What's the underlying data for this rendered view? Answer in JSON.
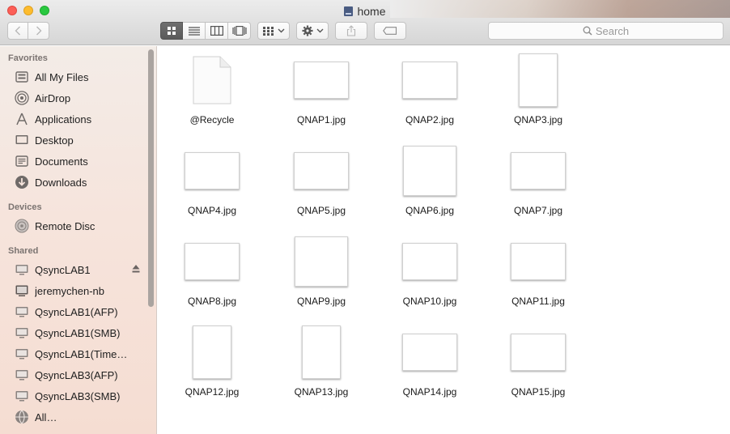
{
  "window": {
    "title": "home"
  },
  "toolbar": {
    "back_icon": "chevron-left-icon",
    "forward_icon": "chevron-right-icon",
    "view_modes": [
      "icon-view",
      "list-view",
      "column-view",
      "cover-flow-view"
    ],
    "active_view": "icon-view",
    "search_placeholder": "Search"
  },
  "sidebar": {
    "sections": [
      {
        "title": "Favorites",
        "items": [
          {
            "label": "All My Files",
            "icon": "all-files-icon"
          },
          {
            "label": "AirDrop",
            "icon": "airdrop-icon"
          },
          {
            "label": "Applications",
            "icon": "applications-icon"
          },
          {
            "label": "Desktop",
            "icon": "desktop-icon"
          },
          {
            "label": "Documents",
            "icon": "documents-icon"
          },
          {
            "label": "Downloads",
            "icon": "downloads-icon"
          }
        ]
      },
      {
        "title": "Devices",
        "items": [
          {
            "label": "Remote Disc",
            "icon": "disc-icon"
          }
        ]
      },
      {
        "title": "Shared",
        "items": [
          {
            "label": "QsyncLAB1",
            "icon": "server-icon"
          },
          {
            "label": "jeremychen-nb",
            "icon": "computer-icon"
          },
          {
            "label": "QsyncLAB1(AFP)",
            "icon": "server-icon"
          },
          {
            "label": "QsyncLAB1(SMB)",
            "icon": "server-icon"
          },
          {
            "label": "QsyncLAB1(Time…",
            "icon": "server-icon"
          },
          {
            "label": "QsyncLAB3(AFP)",
            "icon": "server-icon"
          },
          {
            "label": "QsyncLAB3(SMB)",
            "icon": "server-icon"
          },
          {
            "label": "All…",
            "icon": "network-icon"
          }
        ]
      }
    ]
  },
  "files": [
    {
      "name": "@Recycle",
      "kind": "folder-document"
    },
    {
      "name": "QNAP1.jpg",
      "kind": "image",
      "orientation": "landscape",
      "colors": [
        "#d9c3a0",
        "#8a6a4d",
        "#f0e6d8"
      ]
    },
    {
      "name": "QNAP2.jpg",
      "kind": "image",
      "orientation": "landscape",
      "colors": [
        "#d7c0a0",
        "#7a5b3f",
        "#f2e9dc"
      ]
    },
    {
      "name": "QNAP3.jpg",
      "kind": "image",
      "orientation": "portrait",
      "colors": [
        "#c9d0dc",
        "#ffffff",
        "#6b6f7a"
      ]
    },
    {
      "name": "QNAP4.jpg",
      "kind": "image",
      "orientation": "landscape",
      "colors": [
        "#b9a78e",
        "#3f5876",
        "#e8dfd0"
      ]
    },
    {
      "name": "QNAP5.jpg",
      "kind": "image",
      "orientation": "landscape",
      "colors": [
        "#5a7fa8",
        "#2b3d52",
        "#c8d6e6"
      ]
    },
    {
      "name": "QNAP6.jpg",
      "kind": "image",
      "orientation": "square",
      "colors": [
        "#c48a5c",
        "#6a3f28",
        "#2aa0d0"
      ]
    },
    {
      "name": "QNAP7.jpg",
      "kind": "image",
      "orientation": "landscape",
      "colors": [
        "#1a1a1a",
        "#d9dde3",
        "#555b66"
      ]
    },
    {
      "name": "QNAP8.jpg",
      "kind": "image",
      "orientation": "landscape",
      "colors": [
        "#9fcf6a",
        "#e6d0bd",
        "#5b7a3a"
      ]
    },
    {
      "name": "QNAP9.jpg",
      "kind": "image",
      "orientation": "square",
      "colors": [
        "#4a78b8",
        "#1e2f4e",
        "#d5e2f2"
      ]
    },
    {
      "name": "QNAP10.jpg",
      "kind": "image",
      "orientation": "landscape",
      "colors": [
        "#3b5b8a",
        "#b42b2b",
        "#d9d9d9"
      ]
    },
    {
      "name": "QNAP11.jpg",
      "kind": "image",
      "orientation": "landscape",
      "colors": [
        "#6fb6d9",
        "#2a6b8a",
        "#e6f2f7"
      ]
    },
    {
      "name": "QNAP12.jpg",
      "kind": "image",
      "orientation": "portrait",
      "colors": [
        "#9ccfe0",
        "#ffffff",
        "#3b6c86"
      ]
    },
    {
      "name": "QNAP13.jpg",
      "kind": "image",
      "orientation": "portrait",
      "colors": [
        "#c7c2bb",
        "#f5f3ef",
        "#4b4743"
      ]
    },
    {
      "name": "QNAP14.jpg",
      "kind": "image",
      "orientation": "landscape",
      "colors": [
        "#a9c6dc",
        "#eef3f7",
        "#35536e"
      ]
    },
    {
      "name": "QNAP15.jpg",
      "kind": "image",
      "orientation": "landscape",
      "colors": [
        "#8a6a4b",
        "#d8c3a5",
        "#3d2c1e"
      ]
    }
  ]
}
